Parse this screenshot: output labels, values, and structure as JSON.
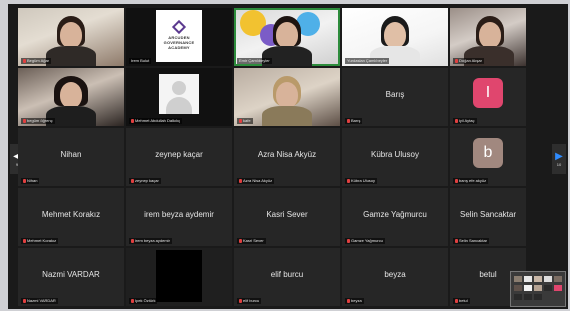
{
  "navigation": {
    "prev_arrow": "◀",
    "next_arrow": "▶",
    "prev_page": "9",
    "next_page": "10"
  },
  "logo": {
    "line1": "ARCUDEN",
    "line2": "GOVERNANCE",
    "line3": "ACADEMY"
  },
  "participants": [
    {
      "id": "p1",
      "label": "Begüm Ağar",
      "type": "video"
    },
    {
      "id": "p2",
      "label": "Irem Bulut",
      "type": "logo"
    },
    {
      "id": "p3",
      "label": "Emir Çamlıbeyler",
      "type": "video"
    },
    {
      "id": "p4",
      "label": "Yurdaslan Çamlıbeyler",
      "type": "video"
    },
    {
      "id": "p5",
      "label": "Doğan Akşar",
      "type": "video"
    },
    {
      "id": "p6",
      "label": "begüm öğrenç",
      "type": "video"
    },
    {
      "id": "p7",
      "label": "Mehmet Abdullah Dalkılıç",
      "type": "placeholder"
    },
    {
      "id": "p8",
      "label": "kafe",
      "type": "video"
    },
    {
      "id": "p9",
      "label": "Barış",
      "center": "Barış",
      "type": "name"
    },
    {
      "id": "p10",
      "label": "iyil Aytaç",
      "avatar": "I",
      "avatar_color": "#e0466e",
      "type": "avatar"
    },
    {
      "id": "p11",
      "label": "Nihan",
      "center": "Nihan",
      "type": "name"
    },
    {
      "id": "p12",
      "label": "zeynep kaçar",
      "center": "zeynep kaçar",
      "type": "name"
    },
    {
      "id": "p13",
      "label": "Azra Nisa Akyüz",
      "center": "Azra Nisa Akyüz",
      "type": "name"
    },
    {
      "id": "p14",
      "label": "Kübra Ulusoy",
      "center": "Kübra Ulusoy",
      "type": "name"
    },
    {
      "id": "p15",
      "label": "barış efe akyüz",
      "avatar": "b",
      "avatar_color": "#a1887f",
      "type": "avatar"
    },
    {
      "id": "p16",
      "label": "Mehmet Korakız",
      "center": "Mehmet Korakız",
      "type": "name"
    },
    {
      "id": "p17",
      "label": "irem beyza aydemir",
      "center": "irem beyza aydemir",
      "type": "name"
    },
    {
      "id": "p18",
      "label": "Kasri Sever",
      "center": "Kasri Sever",
      "type": "name"
    },
    {
      "id": "p19",
      "label": "Gamze Yağmurcu",
      "center": "Gamze Yağmurcu",
      "type": "name"
    },
    {
      "id": "p20",
      "label": "Selin Sancaktar",
      "center": "Selin Sancaktar",
      "type": "name"
    },
    {
      "id": "p21",
      "label": "Nazmi VARDAR",
      "center": "Nazmi VARDAR",
      "type": "name"
    },
    {
      "id": "p22",
      "label": "Ipek Öztürk",
      "type": "black"
    },
    {
      "id": "p23",
      "label": "elif burcu",
      "center": "elif burcu",
      "type": "name"
    },
    {
      "id": "p24",
      "label": "beyza",
      "center": "beyza",
      "type": "name"
    },
    {
      "id": "p25",
      "label": "betul",
      "center": "betul",
      "type": "name"
    }
  ],
  "colors": {
    "background": "#1a1a1a",
    "tile": "#262626",
    "muted_mic": "#e04040",
    "active_speaker": "#2d8c3c",
    "next_arrow": "#2f8cff"
  }
}
